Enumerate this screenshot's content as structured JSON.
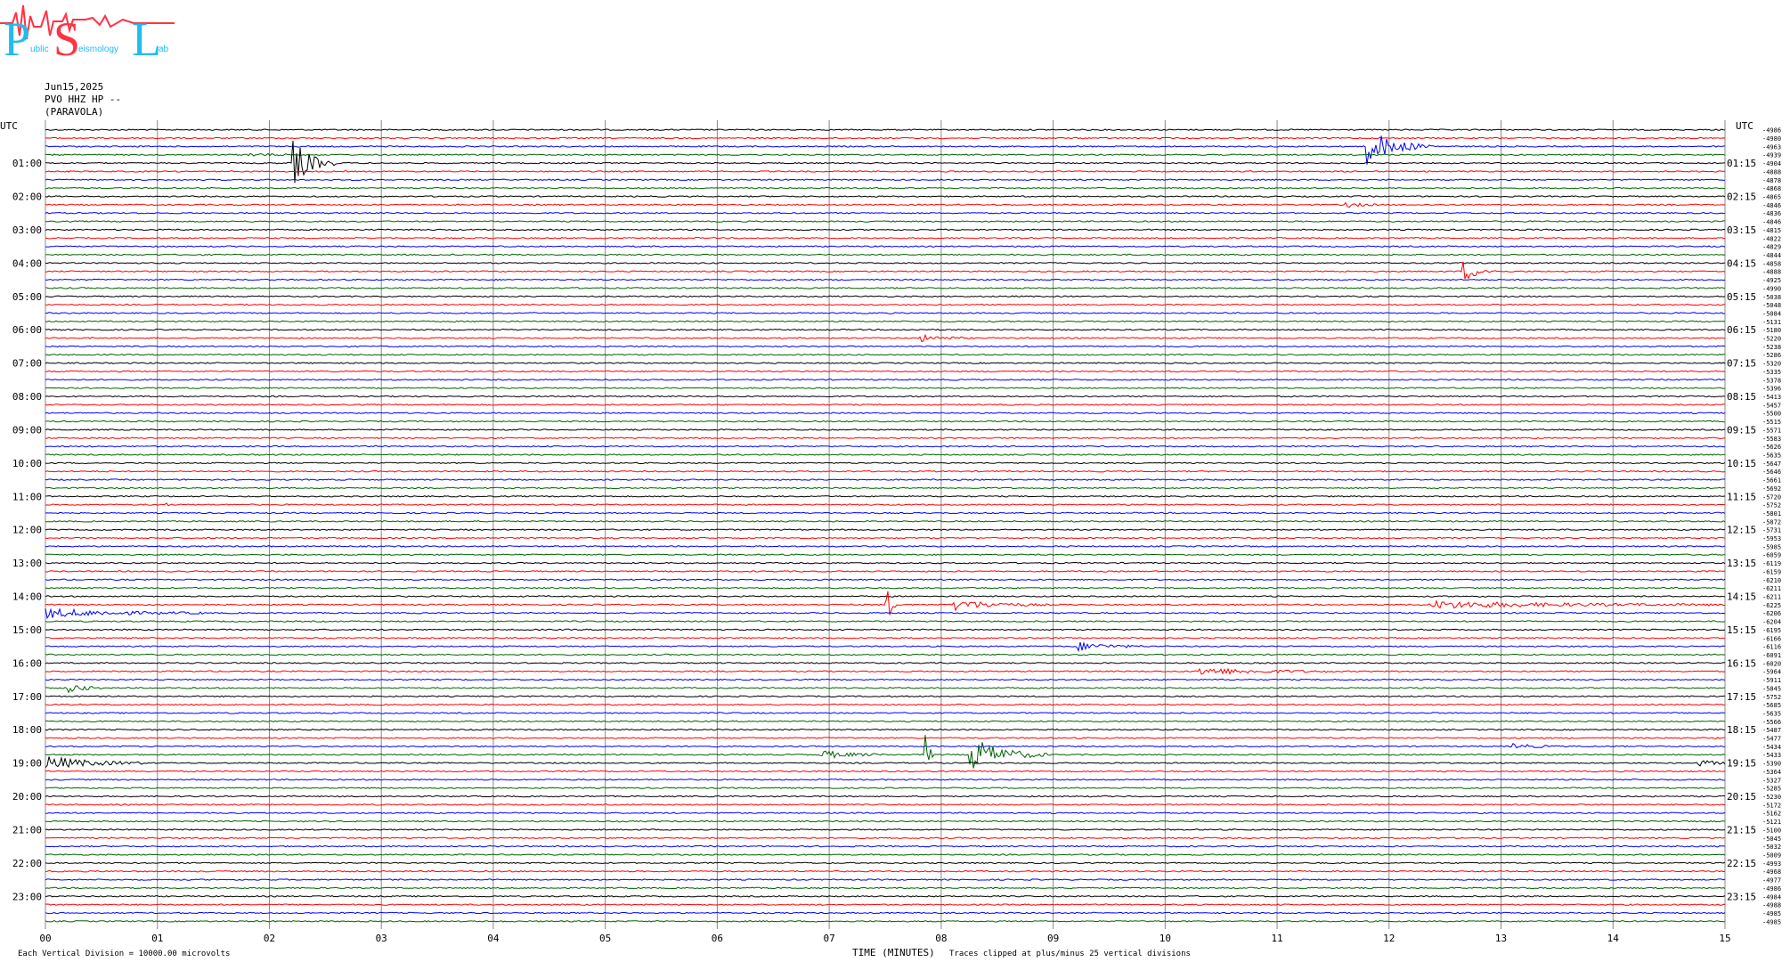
{
  "logo": {
    "big_letters": [
      "P",
      "S",
      "L"
    ],
    "small_text": [
      "ublic",
      "eismology",
      "ab"
    ]
  },
  "header": {
    "date": "Jun15,2025",
    "station": "PVO HHZ HP --",
    "location": "(PARAVOLA)"
  },
  "footer": {
    "division_note": "Each Vertical Division = 10000.00 microvolts",
    "xlabel": "TIME (MINUTES)",
    "clip_note": "Traces clipped at plus/minus 25 vertical divisions"
  },
  "colors": {
    "trace_cycle": [
      "#000000",
      "#ff0000",
      "#0000ff",
      "#006400"
    ],
    "grid": "#888888",
    "logo": "#ff3344",
    "logo_text": "#22bbee"
  },
  "chart_data": {
    "type": "line",
    "title": "",
    "xlabel": "TIME (MINUTES)",
    "xlim": [
      0,
      15
    ],
    "x_ticks": [
      "00",
      "01",
      "02",
      "03",
      "04",
      "05",
      "06",
      "07",
      "08",
      "09",
      "10",
      "11",
      "12",
      "13",
      "14",
      "15"
    ],
    "left_axis_title": "UTC",
    "right_axis_title": "UTC",
    "left_hour_labels": [
      "01:00",
      "02:00",
      "03:00",
      "04:00",
      "05:00",
      "06:00",
      "07:00",
      "08:00",
      "09:00",
      "10:00",
      "11:00",
      "12:00",
      "13:00",
      "14:00",
      "15:00",
      "16:00",
      "17:00",
      "18:00",
      "19:00",
      "20:00",
      "21:00",
      "22:00",
      "23:00"
    ],
    "right_hour_labels": [
      "01:15",
      "02:15",
      "03:15",
      "04:15",
      "05:15",
      "06:15",
      "07:15",
      "08:15",
      "09:15",
      "10:15",
      "11:15",
      "12:15",
      "13:15",
      "14:15",
      "15:15",
      "16:15",
      "17:15",
      "18:15",
      "19:15",
      "20:15",
      "21:15",
      "22:15",
      "23:15"
    ],
    "trace_count": 96,
    "minutes_per_trace": 15,
    "trace_offsets": [
      "-4986",
      "-4980",
      "-4963",
      "-4939",
      "-4904",
      "-4888",
      "-4878",
      "-4868",
      "-4865",
      "-4846",
      "-4836",
      "-4846",
      "-4815",
      "-4822",
      "-4829",
      "-4844",
      "-4858",
      "-4888",
      "-4925",
      "-4990",
      "-5038",
      "-5048",
      "-5084",
      "-5131",
      "-5180",
      "-5220",
      "-5238",
      "-5286",
      "-5320",
      "-5335",
      "-5378",
      "-5396",
      "-5413",
      "-5457",
      "-5500",
      "-5515",
      "-5571",
      "-5583",
      "-5626",
      "-5635",
      "-5647",
      "-5646",
      "-5661",
      "-5692",
      "-5720",
      "-5752",
      "-5801",
      "-5872",
      "-5731",
      "-5953",
      "-5985",
      "-6059",
      "-6119",
      "-6159",
      "-6210",
      "-6211",
      "-6211",
      "-6225",
      "-6206",
      "-6204",
      "-6195",
      "-6166",
      "-6116",
      "-6091",
      "-6020",
      "-5964",
      "-5911",
      "-5845",
      "-5752",
      "-5685",
      "-5635",
      "-5566",
      "-5487",
      "-5477",
      "-5434",
      "-5433",
      "-5390",
      "-5364",
      "-5327",
      "-5285",
      "-5230",
      "-5172",
      "-5162",
      "-5121",
      "-5100",
      "-5045",
      "-5032",
      "-5009",
      "-4993",
      "-4968",
      "-4977",
      "-4986",
      "-4984",
      "-4988",
      "-4985",
      "-4985"
    ],
    "events": [
      {
        "trace": 2,
        "start_min": 11.8,
        "end_min": 12.4,
        "amplitude": 22
      },
      {
        "trace": 3,
        "start_min": 1.8,
        "end_min": 2.2,
        "amplitude": 2
      },
      {
        "trace": 4,
        "start_min": 2.2,
        "end_min": 2.6,
        "amplitude": 30
      },
      {
        "trace": 9,
        "start_min": 11.6,
        "end_min": 11.9,
        "amplitude": 3
      },
      {
        "trace": 17,
        "start_min": 12.65,
        "end_min": 12.95,
        "amplitude": 14
      },
      {
        "trace": 25,
        "start_min": 7.8,
        "end_min": 8.2,
        "amplitude": 4
      },
      {
        "trace": 45,
        "start_min": 1.07,
        "end_min": 1.1,
        "amplitude": 7
      },
      {
        "trace": 57,
        "start_min": 7.5,
        "end_min": 7.6,
        "amplitude": 35
      },
      {
        "trace": 57,
        "start_min": 8.1,
        "end_min": 8.95,
        "amplitude": 6
      },
      {
        "trace": 57,
        "start_min": 12.35,
        "end_min": 15.0,
        "amplitude": 4
      },
      {
        "trace": 58,
        "start_min": 0.0,
        "end_min": 1.4,
        "amplitude": 5
      },
      {
        "trace": 62,
        "start_min": 9.2,
        "end_min": 9.8,
        "amplitude": 5
      },
      {
        "trace": 65,
        "start_min": 10.3,
        "end_min": 11.5,
        "amplitude": 4
      },
      {
        "trace": 67,
        "start_min": 0.2,
        "end_min": 0.5,
        "amplitude": 7
      },
      {
        "trace": 73,
        "start_min": 11.0,
        "end_min": 11.0,
        "amplitude": 0
      },
      {
        "trace": 74,
        "start_min": 13.1,
        "end_min": 13.5,
        "amplitude": 3
      },
      {
        "trace": 75,
        "start_min": 6.9,
        "end_min": 7.5,
        "amplitude": 5
      },
      {
        "trace": 75,
        "start_min": 7.85,
        "end_min": 7.95,
        "amplitude": 28
      },
      {
        "trace": 75,
        "start_min": 8.25,
        "end_min": 8.95,
        "amplitude": 22
      },
      {
        "trace": 76,
        "start_min": 0.0,
        "end_min": 0.9,
        "amplitude": 8
      },
      {
        "trace": 76,
        "start_min": 14.75,
        "end_min": 15.0,
        "amplitude": 6
      }
    ]
  }
}
